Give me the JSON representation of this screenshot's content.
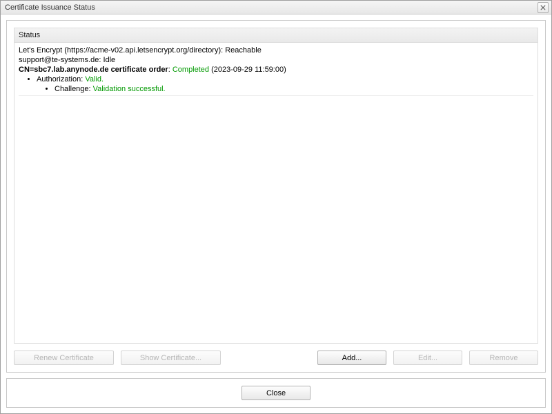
{
  "window": {
    "title": "Certificate Issuance Status"
  },
  "status": {
    "header": "Status",
    "line1_prefix": "Let's Encrypt (",
    "line1_url": "https://acme-v02.api.letsencrypt.org/directory",
    "line1_suffix": "): ",
    "line1_state": "Reachable",
    "line2_prefix": "support@te-systems.de: ",
    "line2_state": "Idle",
    "line3_bold": "CN=sbc7.lab.anynode.de certificate order",
    "line3_colon": ": ",
    "line3_state": "Completed",
    "line3_ts": " (2023-09-29 11:59:00)",
    "auth_label": "Authorization: ",
    "auth_state": "Valid.",
    "challenge_label": "Challenge: ",
    "challenge_state": "Validation successful."
  },
  "buttons": {
    "renew": "Renew Certificate",
    "show": "Show Certificate...",
    "add": "Add...",
    "edit": "Edit...",
    "remove": "Remove",
    "close": "Close"
  }
}
